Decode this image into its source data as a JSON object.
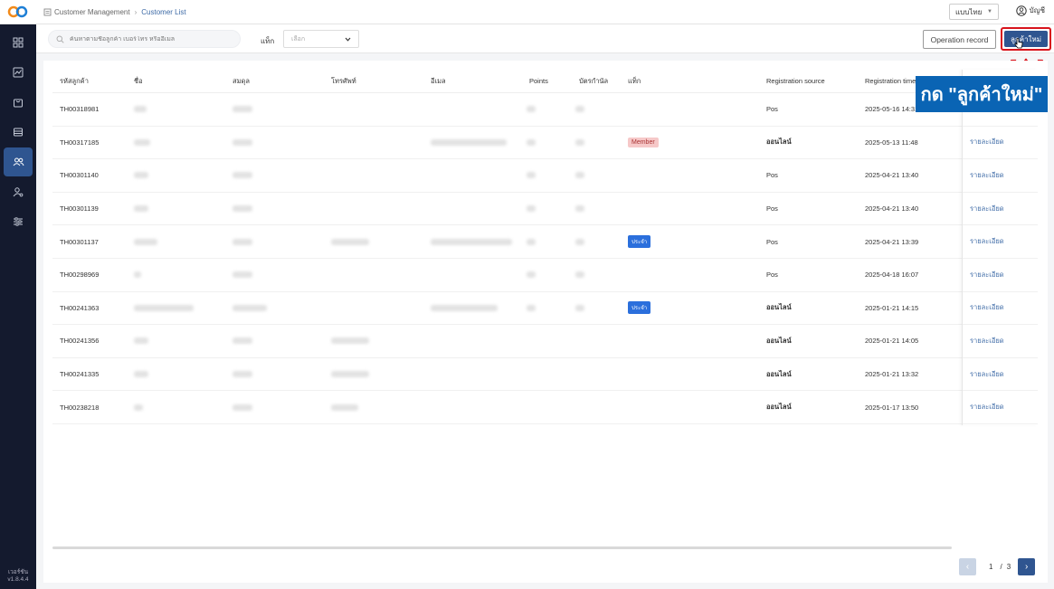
{
  "breadcrumb": {
    "parent": "Customer Management",
    "current": "Customer List"
  },
  "header": {
    "language": "แบบไทย",
    "account": "บัญชี"
  },
  "sidebar": {
    "version_label": "เวอร์ชัน",
    "version": "v1.8.4.4"
  },
  "toolbar": {
    "search_placeholder": "ค้นหาตามชื่อลูกค้า เบอร์โทร หรืออีเมล",
    "tag_label": "แท็ก",
    "tag_select": "เลือก",
    "operation_record": "Operation record",
    "new_customer": "ลูกค้าใหม่"
  },
  "table": {
    "headers": [
      "รหัสลูกค้า",
      "ชื่อ",
      "สมดุล",
      "โทรศัพท์",
      "อีเมล",
      "Points",
      "บัตรกำนัล",
      "แท็ก",
      "Registration source",
      "Registration time"
    ],
    "rows": [
      {
        "id": "TH00318981",
        "tag": "",
        "source": "Pos",
        "time": "2025-05-16 14:31",
        "detail": ""
      },
      {
        "id": "TH00317185",
        "tag": "Member",
        "source": "ออนไลน์",
        "time": "2025-05-13 11:48",
        "detail": "รายละเอียด"
      },
      {
        "id": "TH00301140",
        "tag": "",
        "source": "Pos",
        "time": "2025-04-21 13:40",
        "detail": "รายละเอียด"
      },
      {
        "id": "TH00301139",
        "tag": "",
        "source": "Pos",
        "time": "2025-04-21 13:40",
        "detail": "รายละเอียด"
      },
      {
        "id": "TH00301137",
        "tag": "ประจำ",
        "source": "Pos",
        "time": "2025-04-21 13:39",
        "detail": "รายละเอียด"
      },
      {
        "id": "TH00298969",
        "tag": "",
        "source": "Pos",
        "time": "2025-04-18 16:07",
        "detail": "รายละเอียด"
      },
      {
        "id": "TH00241363",
        "tag": "ประจำ",
        "source": "ออนไลน์",
        "time": "2025-01-21 14:15",
        "detail": "รายละเอียด"
      },
      {
        "id": "TH00241356",
        "tag": "",
        "source": "ออนไลน์",
        "time": "2025-01-21 14:05",
        "detail": "รายละเอียด"
      },
      {
        "id": "TH00241335",
        "tag": "",
        "source": "ออนไลน์",
        "time": "2025-01-21 13:32",
        "detail": "รายละเอียด"
      },
      {
        "id": "TH00238218",
        "tag": "",
        "source": "ออนไลน์",
        "time": "2025-01-17 13:50",
        "detail": "รายละเอียด"
      }
    ]
  },
  "pagination": {
    "current": "1",
    "separator": "/",
    "total": "3"
  },
  "annotation": {
    "text": "กด \"ลูกค้าใหม่\""
  },
  "colors": {
    "sidebar": "#141a2e",
    "primary": "#2f5590",
    "highlight": "#d8141c",
    "annotation": "#0a64b4"
  }
}
